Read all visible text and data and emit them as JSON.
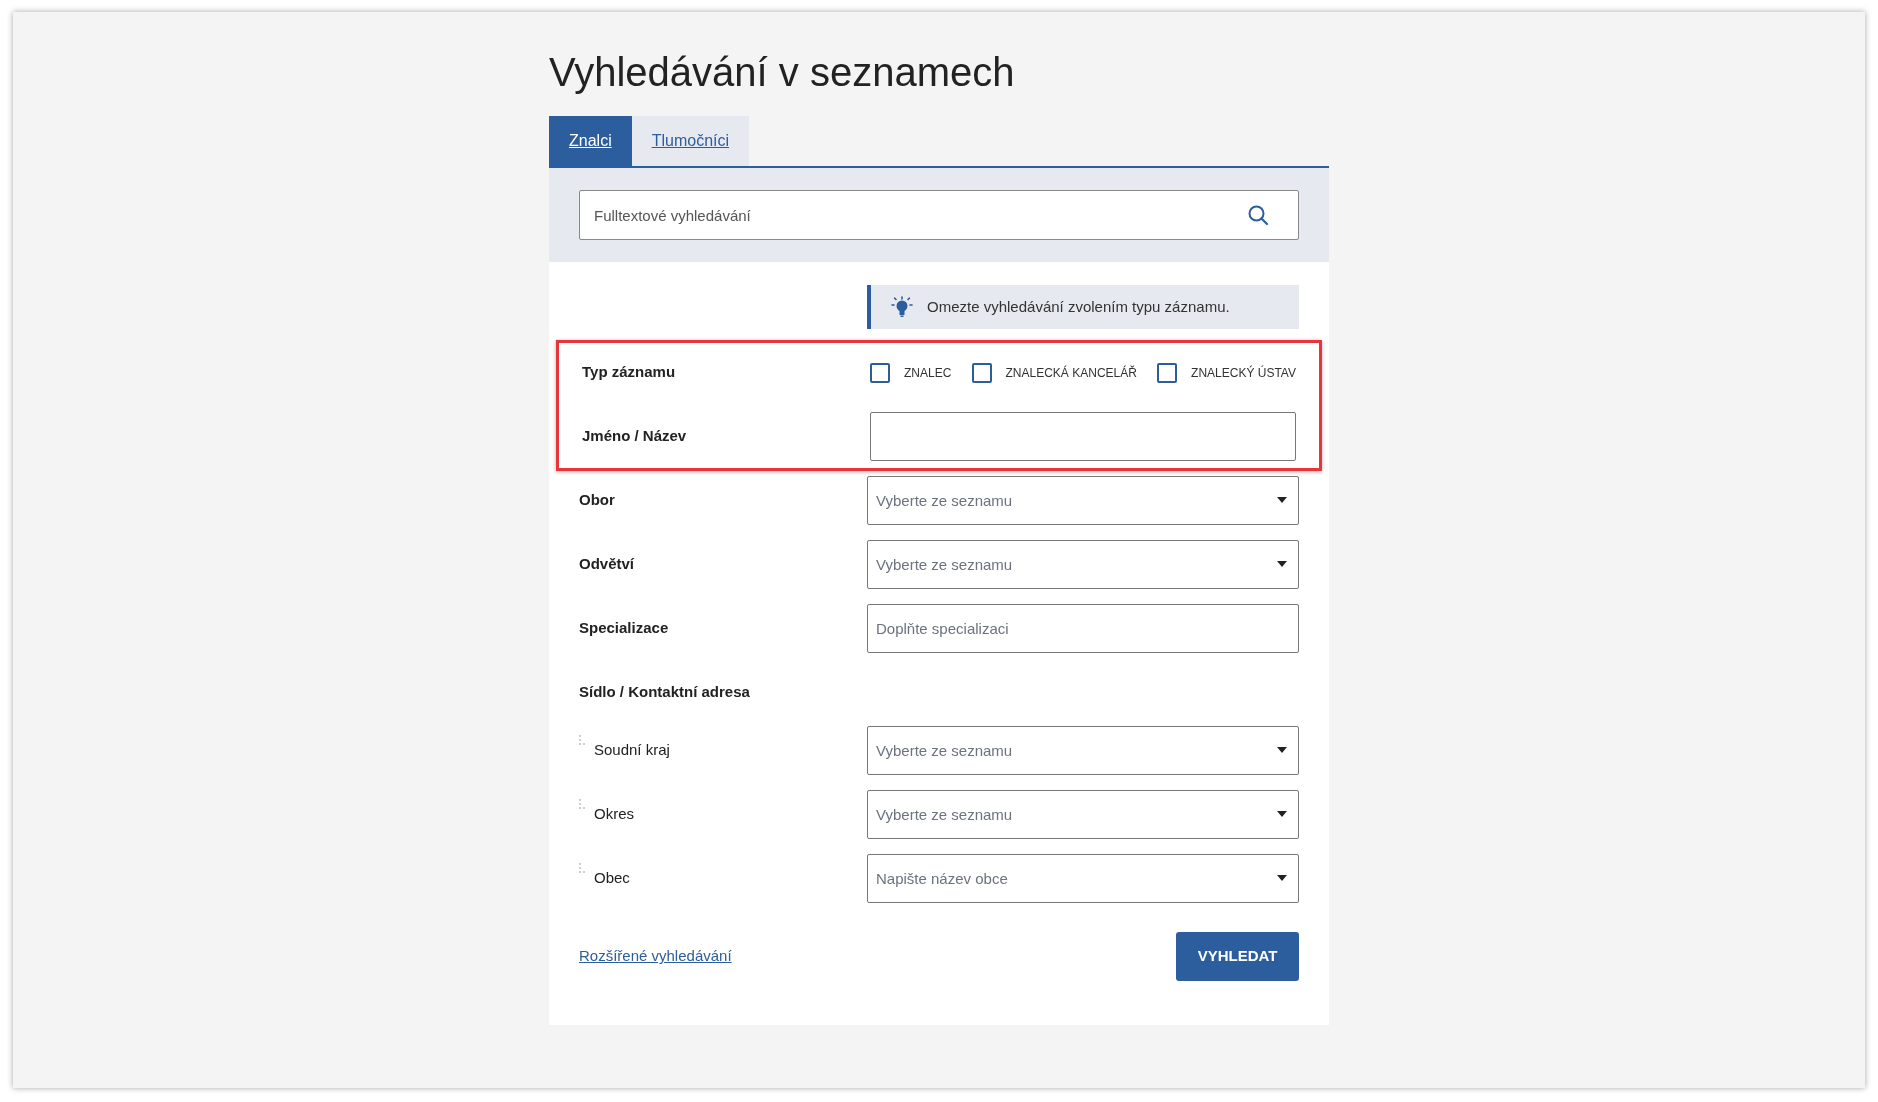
{
  "title": "Vyhledávání v seznamech",
  "tabs": [
    {
      "label": "Znalci",
      "selected": true
    },
    {
      "label": "Tlumočníci",
      "selected": false
    }
  ],
  "search": {
    "placeholder": "Fulltextové vyhledávání"
  },
  "hint": "Omezte vyhledávání zvolením typu záznamu.",
  "highlighted_rows": [
    {
      "kind": "checkboxes",
      "label": "Typ záznamu",
      "options": [
        {
          "label": "ZNALEC",
          "checked": false
        },
        {
          "label": "ZNALECKÁ KANCELÁŘ",
          "checked": false
        },
        {
          "label": "ZNALECKÝ ÚSTAV",
          "checked": false
        }
      ]
    },
    {
      "kind": "text",
      "label": "Jméno / Název"
    }
  ],
  "rows": [
    {
      "kind": "select",
      "label": "Obor",
      "placeholder": "Vyberte ze seznamu"
    },
    {
      "kind": "select",
      "label": "Odvětví",
      "placeholder": "Vyberte ze seznamu"
    },
    {
      "kind": "text",
      "label": "Specializace",
      "placeholder": "Doplňte specializaci"
    },
    {
      "kind": "group",
      "label": "Sídlo / Kontaktní adresa",
      "children": [
        {
          "kind": "select",
          "label": "Soudní kraj",
          "placeholder": "Vyberte ze seznamu"
        },
        {
          "kind": "select",
          "label": "Okres",
          "placeholder": "Vyberte ze seznamu"
        },
        {
          "kind": "select",
          "label": "Obec",
          "placeholder": "Napište název obce"
        }
      ]
    }
  ],
  "advanced_link": "Rozšířené vyhledávání",
  "submit": "VYHLEDAT"
}
